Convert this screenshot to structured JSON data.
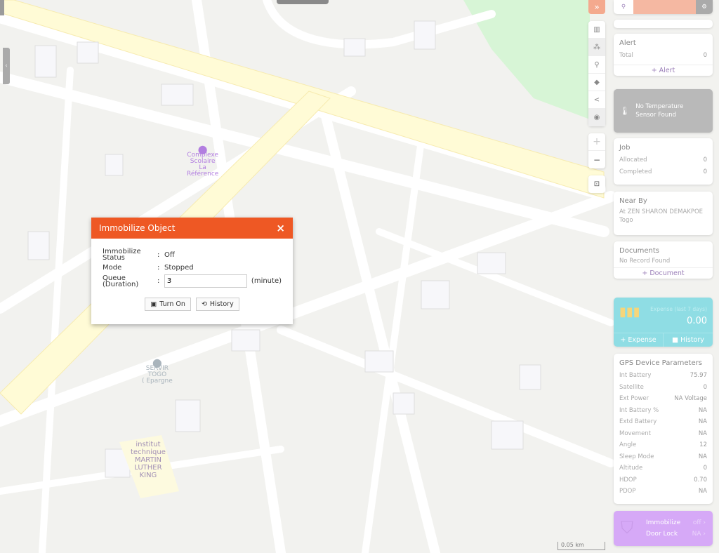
{
  "map": {
    "pois": [
      {
        "name": "Complexe Scolaire La Référence",
        "lines": [
          "Complexe",
          "Scolaire",
          "La",
          "Référence"
        ],
        "color": "#b27ee0"
      },
      {
        "name": "SERVIR TOGO ( Epargne",
        "lines": [
          "SERVIR",
          "TOGO",
          "( Epargne"
        ],
        "color": "#a9b4bc"
      },
      {
        "name": "institut technique MARTIN LUTHER KING",
        "lines": [
          "institut",
          "technique",
          "MARTIN",
          "LUTHER",
          "KING"
        ],
        "color": "#a18fb5"
      }
    ],
    "scale_label": "0.05 km"
  },
  "dialog": {
    "title": "Immobilize Object",
    "close": "×",
    "rows": [
      {
        "key": "Immobilize Status",
        "value": "Off"
      },
      {
        "key": "Mode",
        "value": "Stopped"
      }
    ],
    "queue_key": "Queue (Duration)",
    "queue_value": "3",
    "queue_unit": "(minute)",
    "turn_on": "Turn On",
    "history": "History"
  },
  "toolbar": {
    "expand": "»",
    "zoom_in": "+",
    "zoom_out": "−"
  },
  "panel": {
    "alert": {
      "title": "Alert",
      "total_label": "Total",
      "total": "0",
      "add": "+ Alert"
    },
    "temperature": {
      "text": "No Temperature Sensor Found"
    },
    "job": {
      "title": "Job",
      "allocated_label": "Allocated",
      "allocated": "0",
      "completed_label": "Completed",
      "completed": "0"
    },
    "nearby": {
      "title": "Near By",
      "text": "At ZEN SHARON DEMAKPOE Togo"
    },
    "documents": {
      "title": "Documents",
      "empty": "No Record Found",
      "add": "+ Document"
    },
    "expense": {
      "label": "Expense (last 7 days)",
      "value": "0.00",
      "add": "+ Expense",
      "history": "History",
      "color": "#8fdde4"
    },
    "gps": {
      "title": "GPS Device Parameters",
      "items": [
        {
          "k": "Int Battery",
          "v": "75.97"
        },
        {
          "k": "Satellite",
          "v": "0"
        },
        {
          "k": "Ext Power",
          "v": "NA Voltage"
        },
        {
          "k": "Int Battery %",
          "v": "NA"
        },
        {
          "k": "Extd Battery",
          "v": "NA"
        },
        {
          "k": "Movement",
          "v": "NA"
        },
        {
          "k": "Angle",
          "v": "12"
        },
        {
          "k": "Sleep Mode",
          "v": "NA"
        },
        {
          "k": "Altitude",
          "v": "0"
        },
        {
          "k": "HDOP",
          "v": "0.70"
        },
        {
          "k": "PDOP",
          "v": "NA"
        }
      ]
    },
    "immobilize": {
      "label": "Immobilize",
      "value": "off",
      "door_label": "Door Lock",
      "door_value": "NA",
      "color": "#d6a9f7"
    }
  }
}
